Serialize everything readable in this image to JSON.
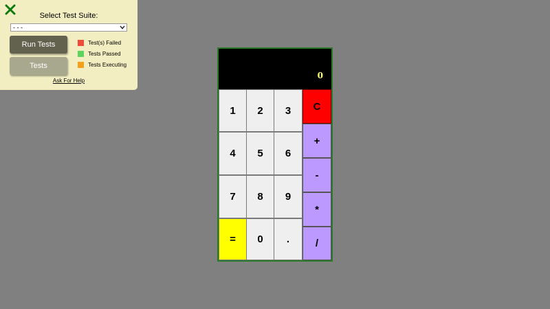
{
  "panel": {
    "title": "Select Test Suite:",
    "select_value": "- - -",
    "run_label": "Run Tests",
    "tests_label": "Tests",
    "help_label": "Ask For Help",
    "legend": [
      {
        "label": "Test(s) Failed",
        "color": "#ef4a3a"
      },
      {
        "label": "Tests Passed",
        "color": "#5fd35f"
      },
      {
        "label": "Tests Executing",
        "color": "#f4a01a"
      }
    ]
  },
  "calculator": {
    "display": "0",
    "keys": {
      "k1": "1",
      "k2": "2",
      "k3": "3",
      "clear": "C",
      "k4": "4",
      "k5": "5",
      "k6": "6",
      "plus": "+",
      "k7": "7",
      "k8": "8",
      "k9": "9",
      "minus": "-",
      "equals": "=",
      "k0": "0",
      "dot": ".",
      "multiply": "*",
      "divide": "/"
    }
  }
}
